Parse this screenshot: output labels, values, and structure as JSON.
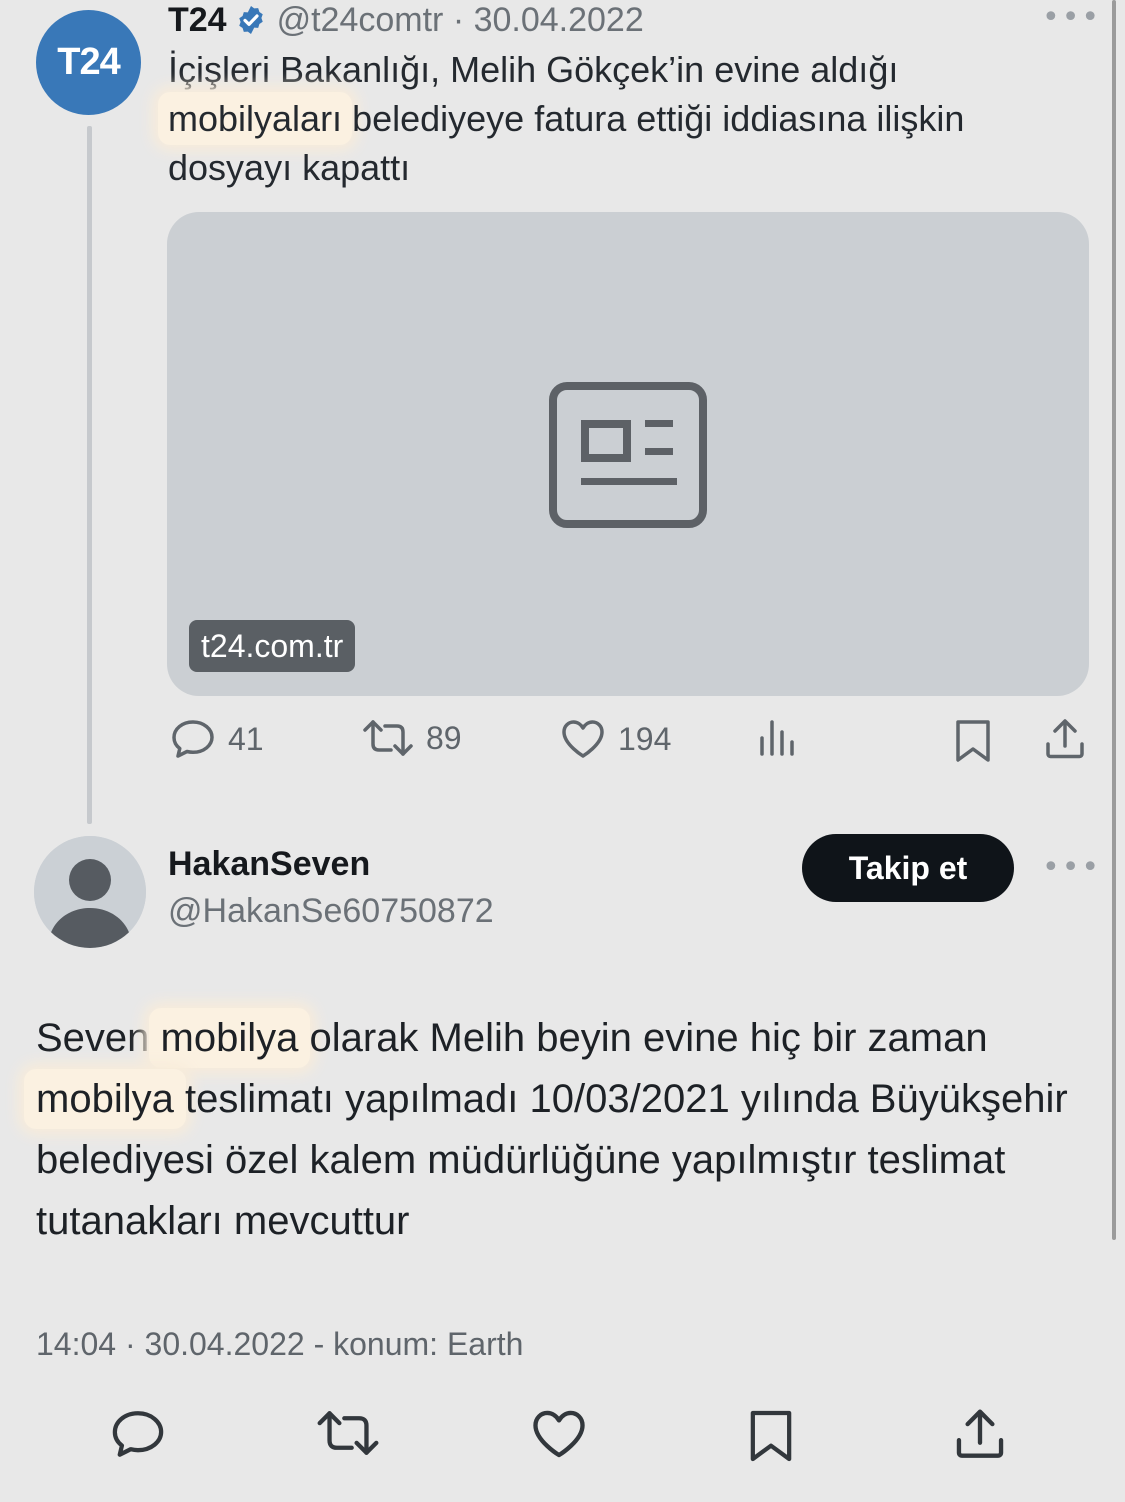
{
  "quoted_tweet": {
    "avatar_text": "T24",
    "name": "T24",
    "handle_date": "@t24comtr · 30.04.2022",
    "text_before": "İçişleri Bakanlığı, Melih Gökçek’in evine aldığı ",
    "text_highlight": "mobilyaları",
    "text_after": " belediyeye fatura ettiği iddiasına ilişkin dosyayı kapattı",
    "link_domain": "t24.com.tr",
    "replies": "41",
    "retweets": "89",
    "likes": "194",
    "more_label": "•••"
  },
  "main_tweet": {
    "name": "HakanSeven",
    "handle": "@HakanSe60750872",
    "follow_label": "Takip et",
    "more_label": "•••",
    "text_part1": "Seven ",
    "text_highlight1": "mobilya",
    "text_part2": " olarak Melih beyin evine hiç bir zaman ",
    "text_highlight2": "mobilya",
    "text_part3": " teslimatı yapılmadı 10/03/2021 yılında Büyükşehir belediyesi özel kalem müdürlüğüne yapılmıştır teslimat tutanakları mevcuttur",
    "meta": "14:04 · 30.04.2022 - konum: Earth"
  },
  "icons": [
    "verified-badge-icon",
    "news-article-icon",
    "reply-icon",
    "retweet-icon",
    "like-icon",
    "views-icon",
    "bookmark-icon",
    "share-icon",
    "more-icon",
    "default-avatar-icon"
  ],
  "colors": {
    "accent": "#3978b8",
    "highlight": "#fbf1e1",
    "follow_button": "#0f1419"
  }
}
